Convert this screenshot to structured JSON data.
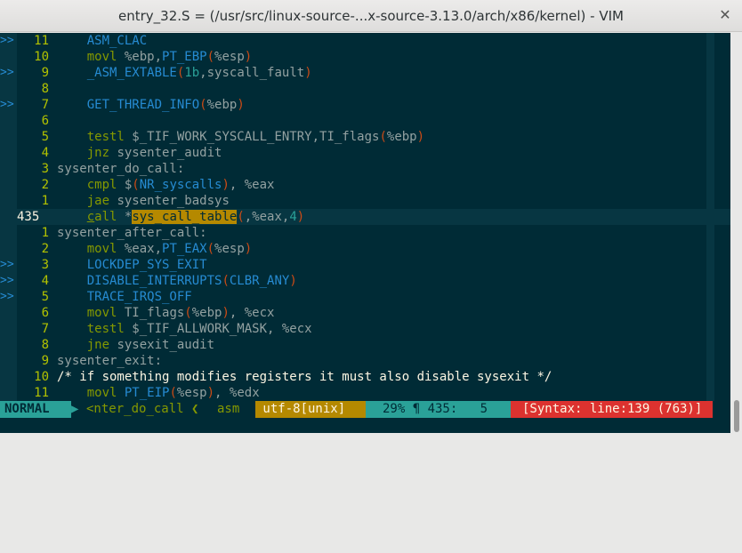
{
  "window": {
    "title": "entry_32.S = (/usr/src/linux-source-...x-source-3.13.0/arch/x86/kernel) - VIM",
    "close_glyph": "✕"
  },
  "colors": {
    "background": "#002b36",
    "line_number": "#b2c200",
    "keyword": "#859900",
    "identifier": "#268bd2",
    "macro": "#cb4b16",
    "highlight": "#b58900",
    "mode": "#2aa198",
    "error": "#dc322f"
  },
  "editor": {
    "lines": [
      {
        "sign": ">>",
        "num": "11",
        "html": "    <span class=\"id\">ASM_CLAC</span>"
      },
      {
        "sign": "",
        "num": "10",
        "html": "    <span class=\"kw\">movl</span> %ebp,<span class=\"id\">PT_EBP</span><span class=\"mac\">(</span>%esp<span class=\"mac\">)</span>"
      },
      {
        "sign": ">>",
        "num": "9",
        "html": "    <span class=\"id\">_ASM_EXTABLE</span><span class=\"mac\">(</span><span class=\"numc\">1b</span>,syscall_fault<span class=\"mac\">)</span>"
      },
      {
        "sign": "",
        "num": "8",
        "html": ""
      },
      {
        "sign": ">>",
        "num": "7",
        "html": "    <span class=\"id\">GET_THREAD_INFO</span><span class=\"mac\">(</span>%ebp<span class=\"mac\">)</span>"
      },
      {
        "sign": "",
        "num": "6",
        "html": ""
      },
      {
        "sign": "",
        "num": "5",
        "html": "    <span class=\"kw\">testl</span> $_TIF_WORK_SYSCALL_ENTRY,TI_flags<span class=\"mac\">(</span>%ebp<span class=\"mac\">)</span>"
      },
      {
        "sign": "",
        "num": "4",
        "html": "    <span class=\"kw\">jnz</span> sysenter_audit"
      },
      {
        "sign": "",
        "num": "3",
        "html": "<span class=\"lab\">sysenter_do_call:</span>"
      },
      {
        "sign": "",
        "num": "2",
        "html": "    <span class=\"kw\">cmpl</span> $<span class=\"mac\">(</span><span class=\"id\">NR_syscalls</span><span class=\"mac\">)</span>, %eax"
      },
      {
        "sign": "",
        "num": "1",
        "html": "    <span class=\"kw\">jae</span> sysenter_badsys"
      },
      {
        "sign": "",
        "num": "435",
        "cursor": true,
        "html": "    <span class=\"kw\"><span class=\"cursorch\">c</span>all</span> *<span class=\"hl\">sys_call_table</span><span class=\"mac\">(</span>,%eax,<span class=\"numc\">4</span><span class=\"mac\">)</span>"
      },
      {
        "sign": "",
        "num": "1",
        "html": "<span class=\"lab\">sysenter_after_call:</span>"
      },
      {
        "sign": "",
        "num": "2",
        "html": "    <span class=\"kw\">movl</span> %eax,<span class=\"id\">PT_EAX</span><span class=\"mac\">(</span>%esp<span class=\"mac\">)</span>"
      },
      {
        "sign": ">>",
        "num": "3",
        "html": "    <span class=\"id\">LOCKDEP_SYS_EXIT</span>"
      },
      {
        "sign": ">>",
        "num": "4",
        "html": "    <span class=\"id\">DISABLE_INTERRUPTS</span><span class=\"mac\">(</span><span class=\"id\">CLBR_ANY</span><span class=\"mac\">)</span>"
      },
      {
        "sign": ">>",
        "num": "5",
        "html": "    <span class=\"id\">TRACE_IRQS_OFF</span>"
      },
      {
        "sign": "",
        "num": "6",
        "html": "    <span class=\"kw\">movl</span> TI_flags<span class=\"mac\">(</span>%ebp<span class=\"mac\">)</span>, %ecx"
      },
      {
        "sign": "",
        "num": "7",
        "html": "    <span class=\"kw\">testl</span> $_TIF_ALLWORK_MASK, %ecx"
      },
      {
        "sign": "",
        "num": "8",
        "html": "    <span class=\"kw\">jne</span> sysexit_audit"
      },
      {
        "sign": "",
        "num": "9",
        "html": "<span class=\"lab\">sysenter_exit:</span>"
      },
      {
        "sign": "",
        "num": "10",
        "html": "<span class=\"cmt\">/* if something modifies registers it must also disable sysexit */</span>"
      },
      {
        "sign": "",
        "num": "11",
        "html": "    <span class=\"kw\">movl</span> <span class=\"id\">PT_EIP</span><span class=\"mac\">(</span>%esp<span class=\"mac\">)</span>, %edx"
      }
    ]
  },
  "statusline": {
    "mode": "NORMAL",
    "mode_arrow": "▶",
    "function": "<nter_do_call ❮",
    "filetype": "asm",
    "encoding": " utf-8[unix] ",
    "position": "29% ¶ 435:   5",
    "syntax_error": "[Syntax: line:139 (763)]"
  }
}
